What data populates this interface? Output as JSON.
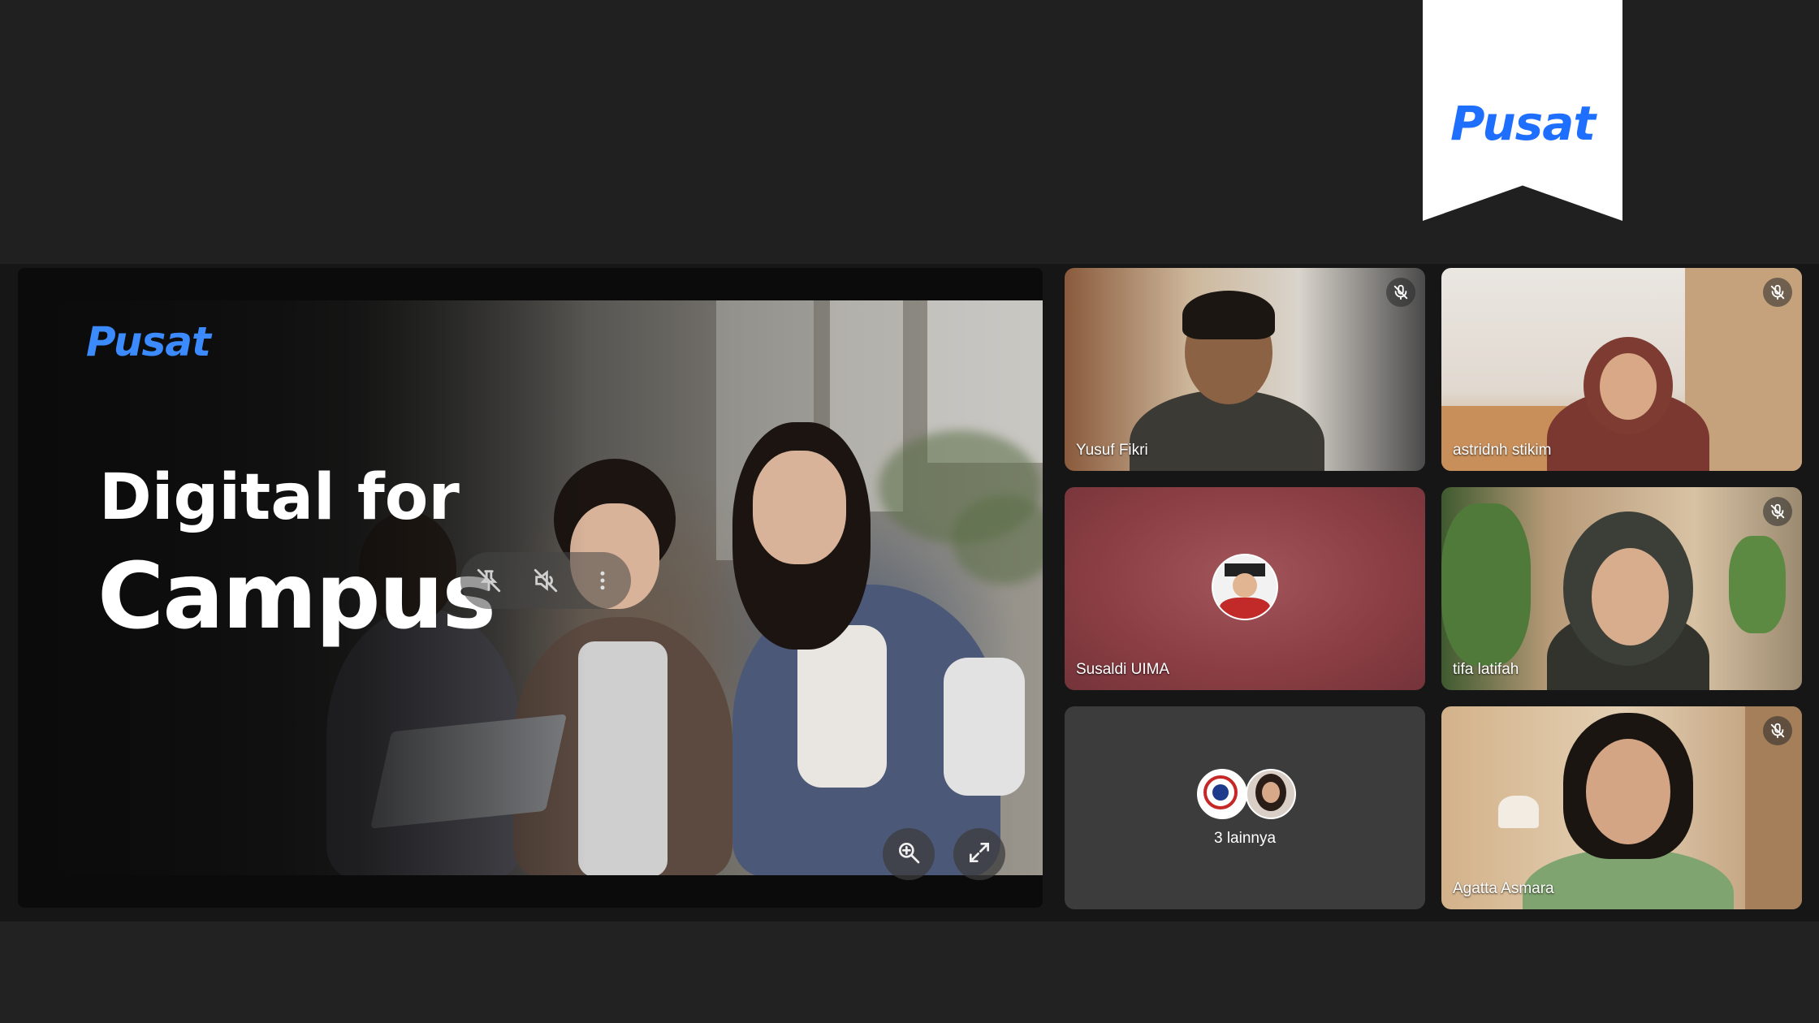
{
  "brand": {
    "name": "Pusat",
    "color": "#1f6fff"
  },
  "presentation": {
    "logo_text": "Pusat",
    "headline_line1": "Digital for",
    "headline_line2": "Campus",
    "toolbar": {
      "pin_icon": "pin-off-icon",
      "mute_icon": "speaker-off-icon",
      "more_icon": "more-vert-icon"
    },
    "controls": {
      "zoom_icon": "zoom-in-icon",
      "fullscreen_icon": "fullscreen-icon"
    }
  },
  "participants": [
    {
      "name": "Yusuf Fikri",
      "muted": true
    },
    {
      "name": "astridnh stikim",
      "muted": true
    },
    {
      "name": "Susaldi UIMA",
      "muted": false
    },
    {
      "name": "tifa latifah",
      "muted": true
    },
    {
      "name": "Agatta Asmara",
      "muted": true
    }
  ],
  "others": {
    "label": "3 lainnya"
  },
  "colors": {
    "background": "#202020",
    "stage": "#161616",
    "tile_dark": "#3c3c3c",
    "tile_red": "#8e3f44"
  }
}
